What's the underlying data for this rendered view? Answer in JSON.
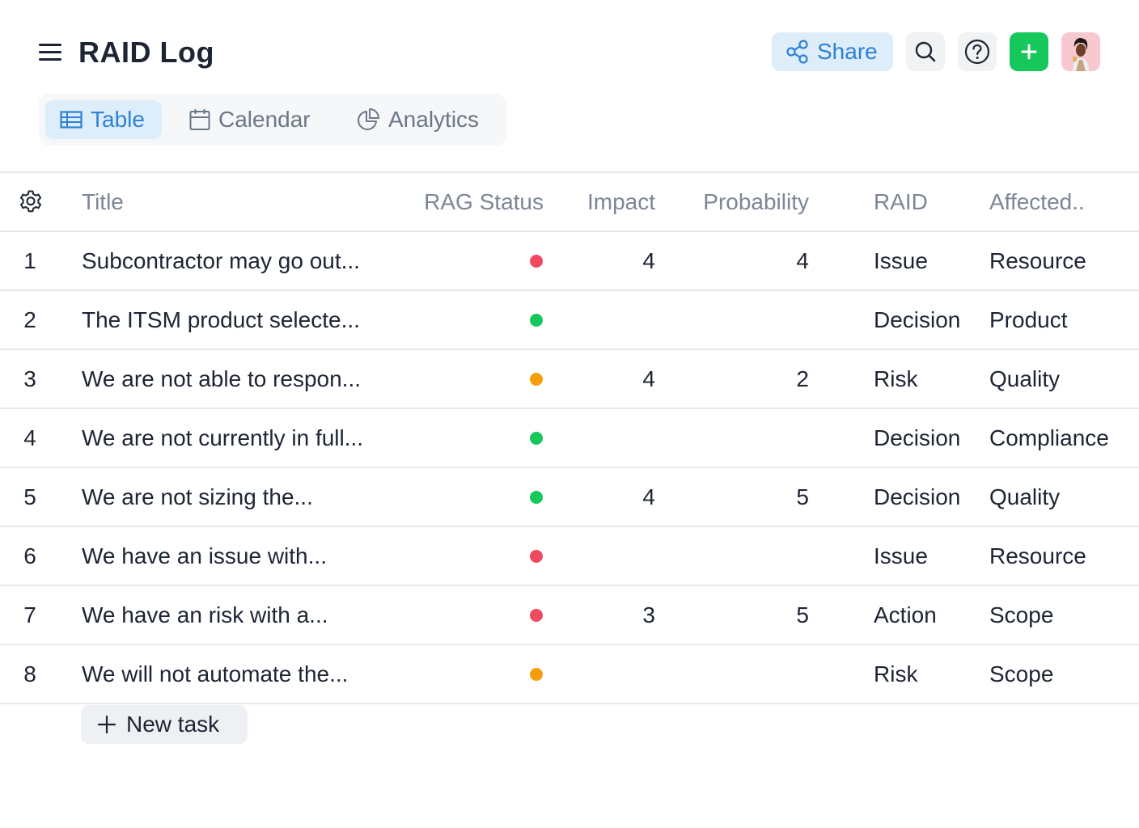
{
  "header": {
    "title": "RAID Log",
    "share_label": "Share",
    "icons": {
      "menu": "hamburger-menu-icon",
      "share": "share-icon",
      "search": "search-icon",
      "help": "help-icon",
      "add": "plus-icon",
      "avatar": "user-avatar"
    }
  },
  "views": [
    {
      "label": "Table",
      "icon": "table-icon",
      "active": true
    },
    {
      "label": "Calendar",
      "icon": "calendar-icon",
      "active": false
    },
    {
      "label": "Analytics",
      "icon": "pie-chart-icon",
      "active": false
    }
  ],
  "table": {
    "settings_icon": "gear-icon",
    "columns": [
      "Title",
      "RAG Status",
      "Impact",
      "Probability",
      "RAID",
      "Affected.."
    ],
    "rows": [
      {
        "num": "1",
        "title": "Subcontractor may go out...",
        "rag": "red",
        "impact": "4",
        "probability": "4",
        "raid": "Issue",
        "affected": "Resource"
      },
      {
        "num": "2",
        "title": "The ITSM product selecte...",
        "rag": "green",
        "impact": "",
        "probability": "",
        "raid": "Decision",
        "affected": "Product"
      },
      {
        "num": "3",
        "title": "We are not able to respon...",
        "rag": "amber",
        "impact": "4",
        "probability": "2",
        "raid": "Risk",
        "affected": "Quality"
      },
      {
        "num": "4",
        "title": "We are not currently in full...",
        "rag": "green",
        "impact": "",
        "probability": "",
        "raid": "Decision",
        "affected": "Compliance"
      },
      {
        "num": "5",
        "title": "We are not sizing the...",
        "rag": "green",
        "impact": "4",
        "probability": "5",
        "raid": "Decision",
        "affected": "Quality"
      },
      {
        "num": "6",
        "title": "We have an issue with...",
        "rag": "red",
        "impact": "",
        "probability": "",
        "raid": "Issue",
        "affected": "Resource"
      },
      {
        "num": "7",
        "title": "We have an risk with a...",
        "rag": "red",
        "impact": "3",
        "probability": "5",
        "raid": "Action",
        "affected": "Scope"
      },
      {
        "num": "8",
        "title": "We will not automate the...",
        "rag": "amber",
        "impact": "",
        "probability": "",
        "raid": "Risk",
        "affected": "Scope"
      }
    ]
  },
  "new_task_label": "New task",
  "colors": {
    "accent": "#2f80d7",
    "add_button": "#16c75b",
    "rag_red": "#ef4a5f",
    "rag_green": "#16c75b",
    "rag_amber": "#f59e0b"
  }
}
